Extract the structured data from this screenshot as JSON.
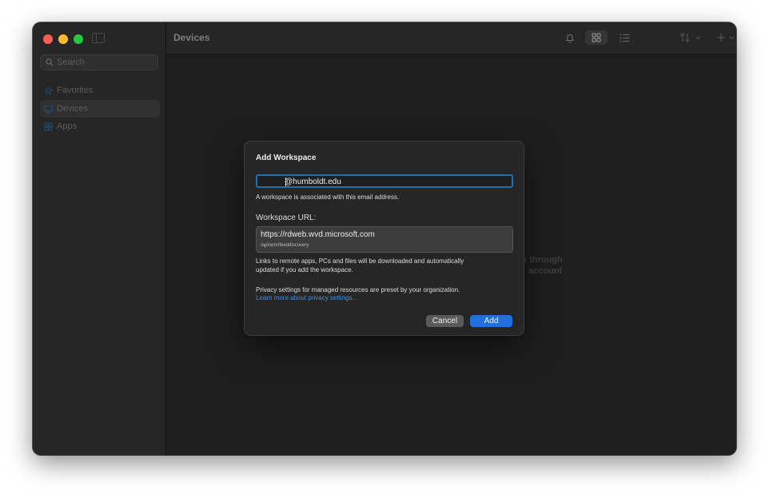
{
  "app": {
    "traffic_lights": {
      "close": "#fe5f57",
      "minimize": "#febc2e",
      "zoom": "#28c840"
    }
  },
  "sidebar": {
    "search_placeholder": "Search",
    "items": [
      {
        "label": "Favorites",
        "icon": "star-icon",
        "active": false
      },
      {
        "label": "Devices",
        "icon": "monitor-icon",
        "active": true
      },
      {
        "label": "Apps",
        "icon": "grid-icon",
        "active": false
      }
    ]
  },
  "toolbar": {
    "title": "Devices",
    "icons": [
      "bell-icon",
      "grid-view-icon",
      "list-view-icon",
      "sort-icon",
      "add-icon",
      "refresh-icon"
    ]
  },
  "background_text": {
    "line1": "s through",
    "line2": "account"
  },
  "dialog": {
    "title": "Add Workspace",
    "email_value": "@humboldt.edu",
    "email_hint": "A workspace is associated with this email address.",
    "url_label": "Workspace URL:",
    "url_main": "https://rdweb.wvd.microsoft.com",
    "url_sub": "/api/arm/feeddiscovery",
    "download_note_1": "Links to remote apps, PCs and files will be downloaded and automatically",
    "download_note_2": "updated if you add the workspace.",
    "privacy_note": "Privacy settings for managed resources are preset by your organization.",
    "privacy_link": "Learn more about privacy settings...",
    "cancel_label": "Cancel",
    "add_label": "Add"
  },
  "colors": {
    "accent": "#1f6fe0",
    "link": "#3c8fe6",
    "focus_ring": "#1f6fb3"
  }
}
